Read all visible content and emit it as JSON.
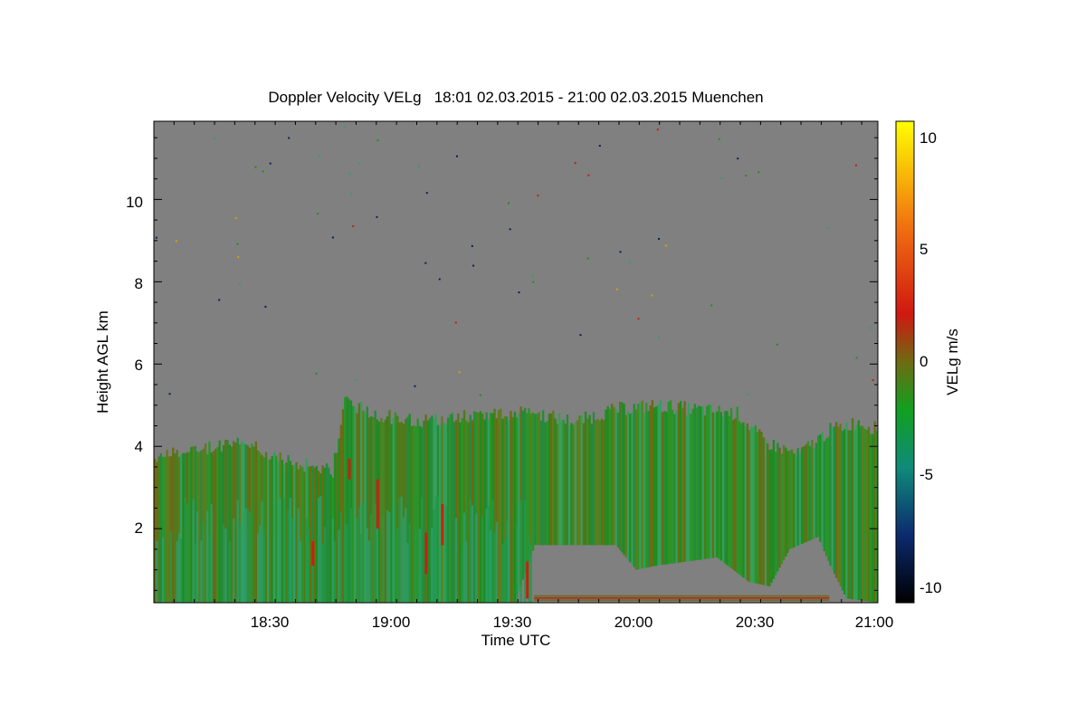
{
  "chart_data": {
    "type": "heatmap",
    "title": "Doppler Velocity VELg   18:01 02.03.2015 - 21:00 02.03.2015 Muenchen",
    "xlabel": "Time UTC",
    "ylabel": "Height AGL km",
    "xlim": [
      "18:01",
      "21:00"
    ],
    "x_ticks": [
      "18:30",
      "19:00",
      "19:30",
      "20:00",
      "20:30",
      "21:00"
    ],
    "ylim": [
      0.2,
      11.9
    ],
    "y_ticks": [
      2,
      4,
      6,
      8,
      10
    ],
    "colorbar": {
      "label": "VELg m/s",
      "range": [
        -10.8,
        10.8
      ],
      "ticks": [
        10,
        5,
        0,
        -5,
        -10
      ],
      "colors": [
        "#000000",
        "#0b2a6e",
        "#0f8a7a",
        "#10a020",
        "#6d6b12",
        "#d01810",
        "#f07010",
        "#ffff00"
      ]
    },
    "background_color": "#808080",
    "grid": false,
    "cloud_top_km": [
      {
        "t": "18:01",
        "h": 3.7
      },
      {
        "t": "18:10",
        "h": 3.9
      },
      {
        "t": "18:20",
        "h": 4.1
      },
      {
        "t": "18:25",
        "h": 4.0
      },
      {
        "t": "18:35",
        "h": 3.6
      },
      {
        "t": "18:45",
        "h": 3.4
      },
      {
        "t": "18:48",
        "h": 5.1
      },
      {
        "t": "18:55",
        "h": 4.8
      },
      {
        "t": "19:05",
        "h": 4.6
      },
      {
        "t": "19:15",
        "h": 4.7
      },
      {
        "t": "19:25",
        "h": 4.8
      },
      {
        "t": "19:35",
        "h": 4.8
      },
      {
        "t": "19:45",
        "h": 4.6
      },
      {
        "t": "19:55",
        "h": 4.9
      },
      {
        "t": "20:05",
        "h": 5.0
      },
      {
        "t": "20:15",
        "h": 4.9
      },
      {
        "t": "20:25",
        "h": 4.8
      },
      {
        "t": "20:32",
        "h": 4.1
      },
      {
        "t": "20:40",
        "h": 3.8
      },
      {
        "t": "20:48",
        "h": 4.4
      },
      {
        "t": "20:55",
        "h": 4.6
      },
      {
        "t": "21:00",
        "h": 4.4
      }
    ],
    "cloud_base_km": [
      {
        "t": "18:01",
        "h": 0.2
      },
      {
        "t": "19:30",
        "h": 0.2
      },
      {
        "t": "19:35",
        "h": 1.6
      },
      {
        "t": "19:55",
        "h": 1.6
      },
      {
        "t": "20:00",
        "h": 1.0
      },
      {
        "t": "20:05",
        "h": 1.1
      },
      {
        "t": "20:20",
        "h": 1.3
      },
      {
        "t": "20:28",
        "h": 0.7
      },
      {
        "t": "20:33",
        "h": 0.6
      },
      {
        "t": "20:38",
        "h": 1.5
      },
      {
        "t": "20:45",
        "h": 1.8
      },
      {
        "t": "20:48",
        "h": 1.1
      },
      {
        "t": "20:52",
        "h": 0.3
      },
      {
        "t": "21:00",
        "h": 0.2
      }
    ]
  }
}
